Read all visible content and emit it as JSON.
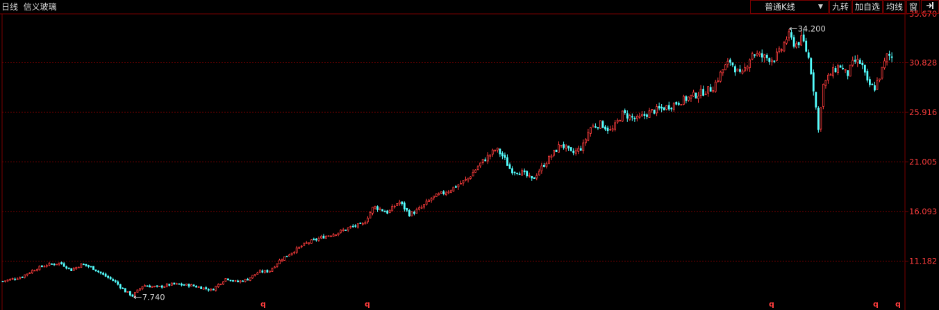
{
  "header": {
    "period": "日线",
    "stock_name": "信义玻璃"
  },
  "toolbar": {
    "kline_type": "普通K线",
    "jiuzhuan": "九转",
    "add_favorite": "加自选",
    "moving_average": "均线",
    "window": "窗",
    "exit_icon": "exit-icon"
  },
  "colors": {
    "up": "#ff3d3d",
    "down": "#54ffff",
    "grid": "#7a0000",
    "axis_label": "#ff3d3d",
    "background": "#000000"
  },
  "chart_data": {
    "type": "candlestick",
    "y_ticks": [
      "35.670",
      "30.828",
      "25.916",
      "21.005",
      "16.093",
      "11.182"
    ],
    "ylim": [
      7.2,
      35.67
    ],
    "high_marker": "34.200",
    "low_marker": "7.740",
    "event_marker": "q",
    "event_marker_count": 5,
    "close_path": [
      [
        0,
        9.2
      ],
      [
        25,
        9.6
      ],
      [
        45,
        10.4
      ],
      [
        60,
        10.8
      ],
      [
        80,
        11.0
      ],
      [
        95,
        10.3
      ],
      [
        110,
        10.9
      ],
      [
        125,
        10.5
      ],
      [
        140,
        9.8
      ],
      [
        155,
        9.2
      ],
      [
        170,
        8.2
      ],
      [
        180,
        7.74
      ],
      [
        195,
        8.8
      ],
      [
        215,
        8.6
      ],
      [
        235,
        8.9
      ],
      [
        260,
        8.8
      ],
      [
        280,
        8.5
      ],
      [
        290,
        8.3
      ],
      [
        310,
        9.5
      ],
      [
        325,
        9.1
      ],
      [
        340,
        9.4
      ],
      [
        355,
        10.1
      ],
      [
        370,
        10.2
      ],
      [
        385,
        11.3
      ],
      [
        400,
        12.0
      ],
      [
        420,
        12.9
      ],
      [
        445,
        13.6
      ],
      [
        465,
        14.0
      ],
      [
        485,
        14.6
      ],
      [
        500,
        14.8
      ],
      [
        515,
        16.6
      ],
      [
        535,
        16.0
      ],
      [
        550,
        17.1
      ],
      [
        565,
        15.8
      ],
      [
        580,
        16.4
      ],
      [
        595,
        17.4
      ],
      [
        620,
        18.2
      ],
      [
        645,
        19.3
      ],
      [
        665,
        21.0
      ],
      [
        685,
        22.3
      ],
      [
        695,
        21.5
      ],
      [
        705,
        20.2
      ],
      [
        720,
        20.0
      ],
      [
        735,
        19.2
      ],
      [
        745,
        20.2
      ],
      [
        760,
        21.5
      ],
      [
        775,
        22.8
      ],
      [
        790,
        21.8
      ],
      [
        805,
        22.5
      ],
      [
        815,
        24.4
      ],
      [
        830,
        24.8
      ],
      [
        845,
        24.0
      ],
      [
        860,
        25.8
      ],
      [
        880,
        25.2
      ],
      [
        900,
        26.0
      ],
      [
        920,
        26.4
      ],
      [
        940,
        27.0
      ],
      [
        960,
        27.6
      ],
      [
        985,
        28.3
      ],
      [
        1000,
        30.2
      ],
      [
        1010,
        31.0
      ],
      [
        1025,
        29.4
      ],
      [
        1040,
        31.8
      ],
      [
        1055,
        31.4
      ],
      [
        1070,
        31.2
      ],
      [
        1080,
        32.0
      ],
      [
        1090,
        33.6
      ],
      [
        1100,
        32.6
      ],
      [
        1110,
        33.2
      ],
      [
        1120,
        31.0
      ],
      [
        1128,
        27.0
      ],
      [
        1132,
        24.0
      ],
      [
        1138,
        28.5
      ],
      [
        1150,
        29.8
      ],
      [
        1162,
        30.6
      ],
      [
        1172,
        29.6
      ],
      [
        1182,
        31.0
      ],
      [
        1192,
        30.8
      ],
      [
        1200,
        28.8
      ],
      [
        1210,
        28.3
      ],
      [
        1218,
        29.6
      ],
      [
        1228,
        31.6
      ],
      [
        1236,
        31.3
      ]
    ]
  }
}
